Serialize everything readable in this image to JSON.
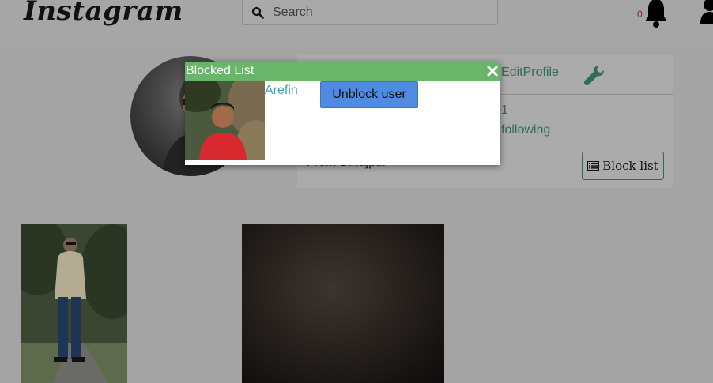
{
  "navbar": {
    "logo_text": "Instagram",
    "search": {
      "placeholder": "Search",
      "value": ""
    },
    "notification_count": "0",
    "icons": [
      "search-icon",
      "bell-icon",
      "user-icon"
    ]
  },
  "profile": {
    "edit_link": "EditProfile",
    "followers_count": "1",
    "following_label": "following",
    "from_text": "From Dinajpur",
    "block_list_label": "Block list",
    "icons": [
      "wrench-icon",
      "list-icon"
    ]
  },
  "modal": {
    "title": "Blocked List",
    "blocked_users": [
      {
        "name": "Arefin",
        "action_label": "Unblock user"
      }
    ],
    "icons": [
      "close-icon"
    ]
  },
  "colors": {
    "modal_header": "#69b56a",
    "link": "#2f6b5b",
    "blocked_name": "#3ba0b6",
    "unblock_button": "#4f8be0"
  }
}
